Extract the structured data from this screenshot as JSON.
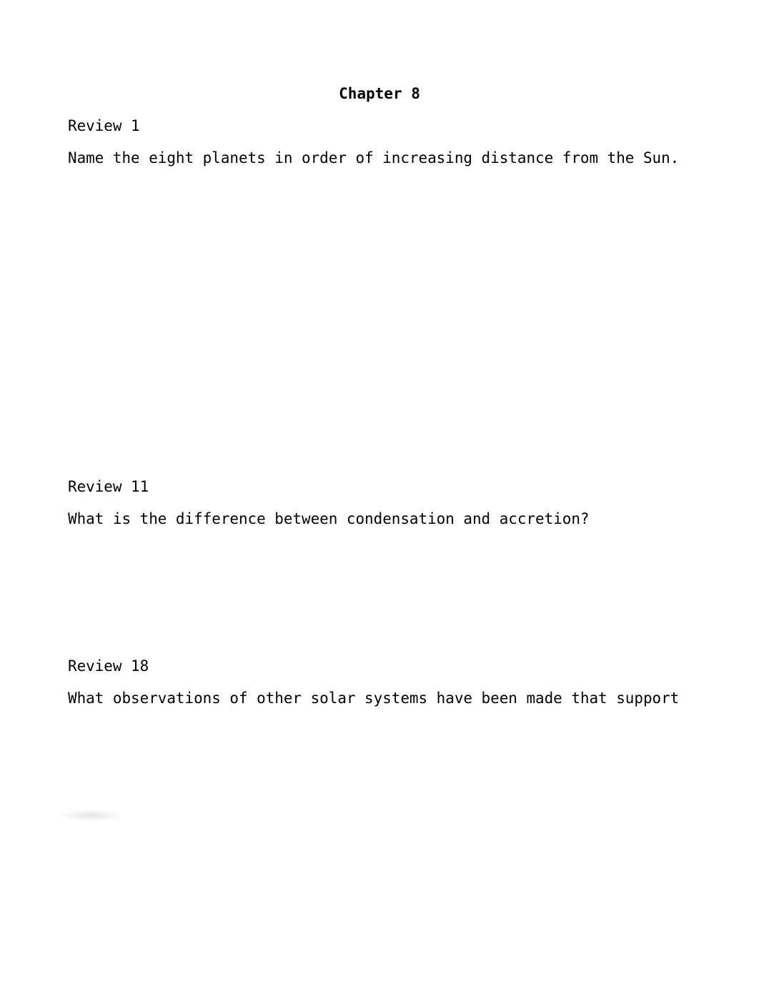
{
  "document": {
    "title": "Chapter 8",
    "questions": [
      {
        "label": "Review 1",
        "text": "Name the eight planets in order of increasing distance from the Sun."
      },
      {
        "label": "Review 11",
        "text": "What is the difference between condensation and accretion?"
      },
      {
        "label": "Review 18",
        "text": "What observations of other solar systems have been made that support"
      }
    ]
  }
}
